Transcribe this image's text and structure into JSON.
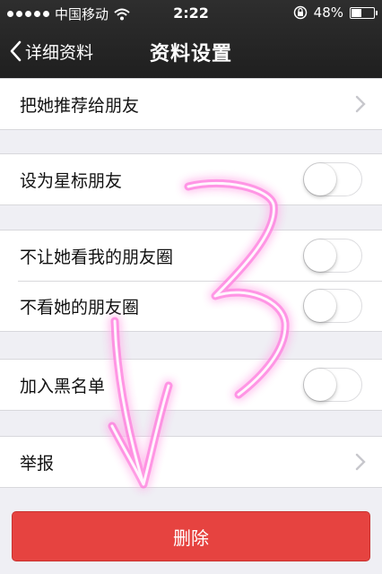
{
  "status_bar": {
    "carrier": "中国移动",
    "time": "2:22",
    "battery_text": "48%",
    "battery_level": 0.48
  },
  "nav": {
    "back_label": "详细资料",
    "title": "资料设置"
  },
  "items": {
    "recommend": "把她推荐给朋友",
    "star": "设为星标朋友",
    "hide_my_moments": "不让她看我的朋友圈",
    "hide_her_moments": "不看她的朋友圈",
    "blacklist": "加入黑名单",
    "report": "举报"
  },
  "toggles": {
    "star": false,
    "hide_my_moments": false,
    "hide_her_moments": false,
    "blacklist": false
  },
  "delete_label": "删除",
  "colors": {
    "delete_button": "#e64340",
    "nav_background": "#262626",
    "page_background": "#efeff4",
    "annotation": "#ff4fd8"
  }
}
